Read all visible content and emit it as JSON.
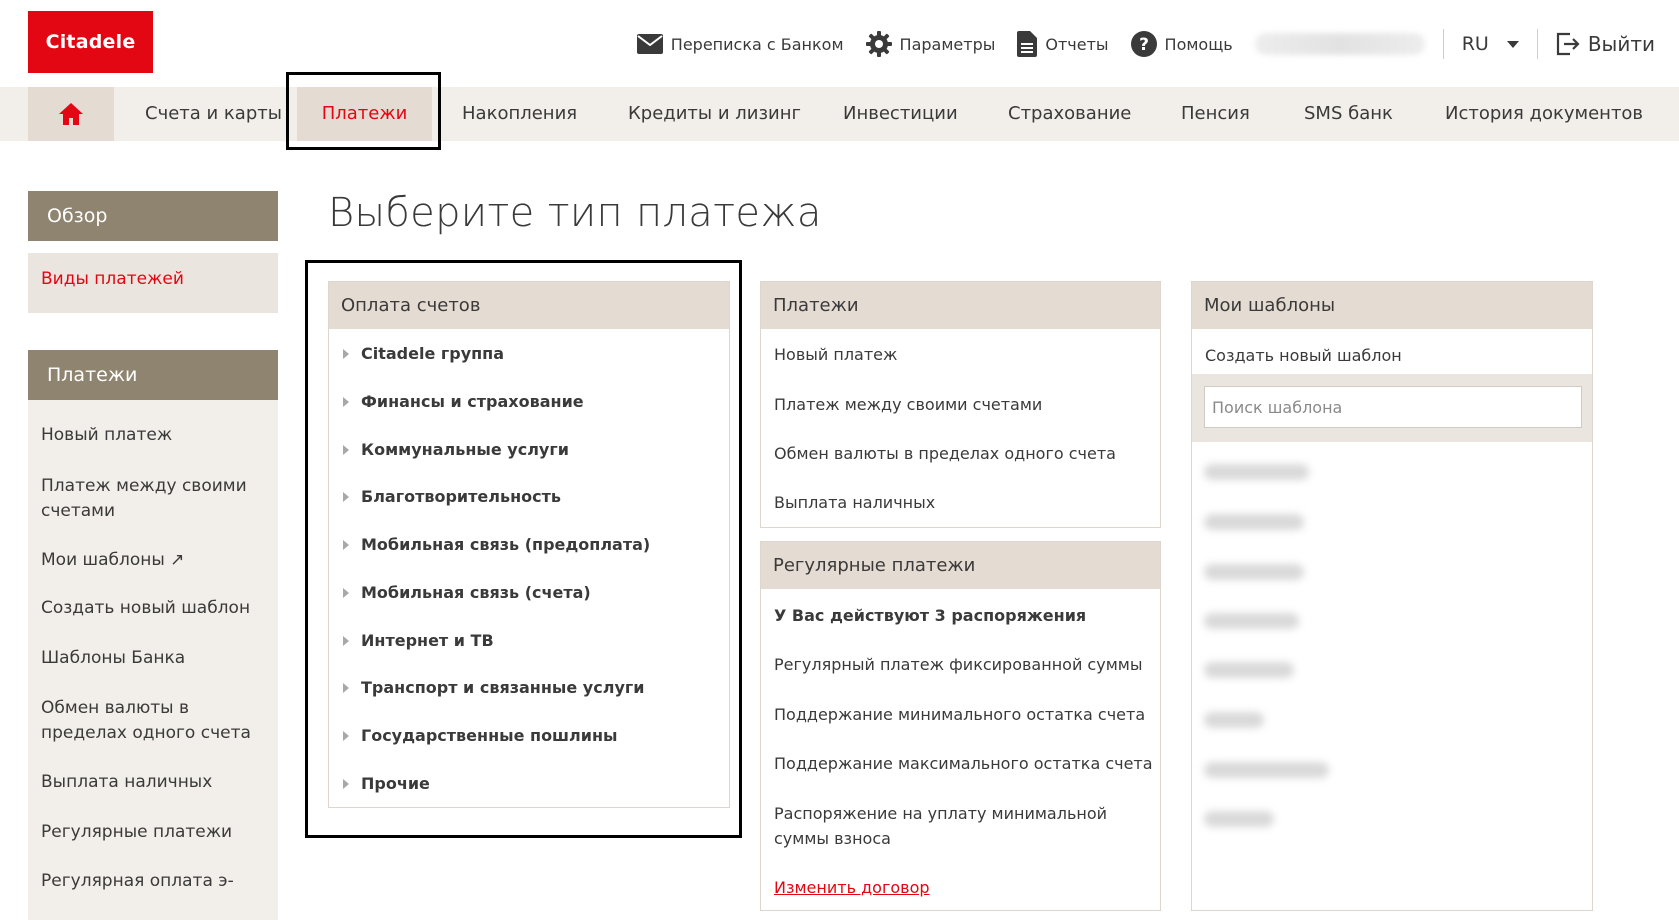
{
  "brand": {
    "logo_text": "Citadele",
    "accent": "#e30613",
    "nav_bg": "#f2eee9",
    "panel_head_bg": "#e4dbd2",
    "side_head_bg": "#8e8470"
  },
  "topbar": {
    "links": [
      {
        "label": "Переписка с Банком",
        "icon": "envelope-icon"
      },
      {
        "label": "Параметры",
        "icon": "gear-icon"
      },
      {
        "label": "Отчеты",
        "icon": "document-icon"
      },
      {
        "label": "Помощь",
        "icon": "help-icon"
      }
    ],
    "language": "RU",
    "logout": "Выйти"
  },
  "nav": {
    "items": [
      "Счета и карты",
      "Платежи",
      "Накопления",
      "Кредиты и лизинг",
      "Инвестиции",
      "Страхование",
      "Пенсия",
      "SMS банк",
      "История документов"
    ],
    "active": "Платежи"
  },
  "sidebar": {
    "overview_title": "Обзор",
    "overview_active": "Виды платежей",
    "payments_title": "Платежи",
    "items": [
      "Новый платеж",
      "Платеж между своими счетами",
      "Мои шаблоны ↗",
      "Создать новый шаблон",
      "Шаблоны Банка",
      "Обмен валюты в пределах одного счета",
      "Выплата наличных",
      "Регулярные платежи",
      "Регулярная оплата э-"
    ]
  },
  "main": {
    "title": "Выберите тип платежа",
    "bills": {
      "title": "Оплата счетов",
      "items": [
        "Citadele группа",
        "Финансы и страхование",
        "Коммунальные услуги",
        "Благотворительность",
        "Мобильная связь (предоплата)",
        "Мобильная связь (счета)",
        "Интернет и ТВ",
        "Транспорт и связанные услуги",
        "Государственные пошлины",
        "Прочие"
      ]
    },
    "payments": {
      "title": "Платежи",
      "items": [
        "Новый платеж",
        "Платеж между своими счетами",
        "Обмен валюты в пределах одного счета",
        "Выплата наличных"
      ]
    },
    "regular": {
      "title": "Регулярные платежи",
      "status": "У Вас действуют 3 распоряжения",
      "items": [
        "Регулярный платеж фиксированной суммы",
        "Поддержание минимального остатка счета",
        "Поддержание максимального остатка счета",
        "Распоряжение на уплату минимальной суммы взноса"
      ],
      "change_link": "Изменить договор"
    },
    "templates": {
      "title": "Мои шаблоны",
      "create": "Создать новый шаблон",
      "search_placeholder": "Поиск шаблона"
    }
  }
}
